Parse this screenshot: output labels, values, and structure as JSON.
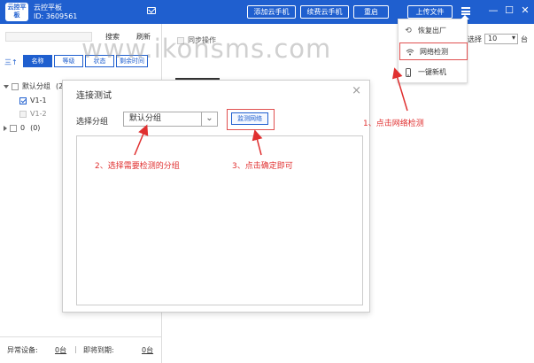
{
  "app": {
    "logo": "云控平板",
    "name": "云控平板",
    "id": "ID: 3609561"
  },
  "toolbar": {
    "add_phone": "添加云手机",
    "renew_phone": "续费云手机",
    "restart": "重启",
    "upload_file": "上传文件"
  },
  "window_controls": {
    "minimize": "—",
    "maximize": "☐",
    "close": "✕"
  },
  "left_panel": {
    "search_label": "搜索",
    "refresh_label": "刷新",
    "sort_icon": "三↑",
    "tabs": [
      "名称",
      "等级",
      "状态",
      "剩余时间"
    ],
    "tree": {
      "group": "默认分组",
      "group_count": "(2",
      "items": [
        "V1-1",
        "V1-2"
      ],
      "other_group": "0",
      "other_count": "(0)"
    },
    "footer": {
      "abnormal_label": "异常设备:",
      "abnormal_value": "0台",
      "expiring_label": "即将到期:",
      "expiring_value": "0台"
    }
  },
  "main": {
    "sync_label": "同步操作",
    "select_label": "选择",
    "select_value": "10",
    "unit": "台"
  },
  "watermark": "www.ikonsms.com",
  "dropdown_menu": {
    "items": [
      {
        "label": "恢复出厂",
        "icon": "reset-icon"
      },
      {
        "label": "网络检测",
        "icon": "wifi-icon"
      },
      {
        "label": "一键新机",
        "icon": "phone-icon"
      }
    ]
  },
  "dialog": {
    "title": "连接测试",
    "close": "×",
    "group_label": "选择分组",
    "group_value": "默认分组",
    "test_button": "监测网络"
  },
  "annotations": {
    "step1": "1、点击网络检测",
    "step2": "2、选择需要检测的分组",
    "step3": "3、点击确定即可"
  },
  "colors": {
    "brand": "#1f5fcf",
    "annotation": "#e03030"
  }
}
